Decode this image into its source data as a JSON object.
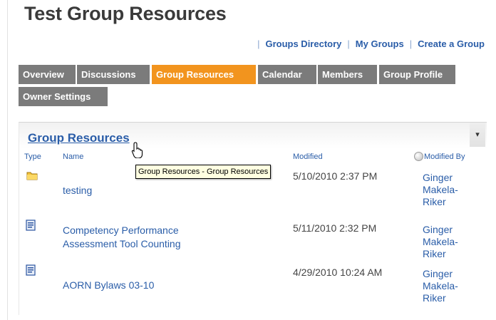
{
  "page_title": "Test Group Resources",
  "top_links": [
    "Groups Directory",
    "My Groups",
    "Create a Group"
  ],
  "tabs": [
    "Overview",
    "Discussions",
    "Group Resources",
    "Calendar",
    "Members",
    "Group Profile",
    "Owner Settings"
  ],
  "active_tab": "Group Resources",
  "panel": {
    "title": "Group Resources",
    "menu_glyph": "▾",
    "columns": {
      "type": "Type",
      "name": "Name",
      "modified": "Modified",
      "modified_by": "Modified By"
    }
  },
  "tooltip": "Group Resources - Group Resources",
  "rows": [
    {
      "type_icon": "folder-icon",
      "name_lines": [
        "testing"
      ],
      "modified": "5/10/2010 2:37 PM",
      "modified_by": [
        "Ginger",
        "Makela-",
        "Riker"
      ]
    },
    {
      "type_icon": "document-icon",
      "name_lines": [
        "Competency Performance",
        "Assessment Tool Counting"
      ],
      "modified": "5/11/2010 2:32 PM",
      "modified_by": [
        "Ginger",
        "Makela-",
        "Riker"
      ]
    },
    {
      "type_icon": "document-icon",
      "name_lines": [
        "AORN Bylaws 03-10"
      ],
      "modified": "4/29/2010 10:24 AM",
      "modified_by": [
        "Ginger",
        "Makela-",
        "Riker"
      ]
    }
  ],
  "colors": {
    "accent_orange": "#f2941e",
    "tab_gray": "#7b7b7b",
    "link_blue": "#2a5da8"
  }
}
